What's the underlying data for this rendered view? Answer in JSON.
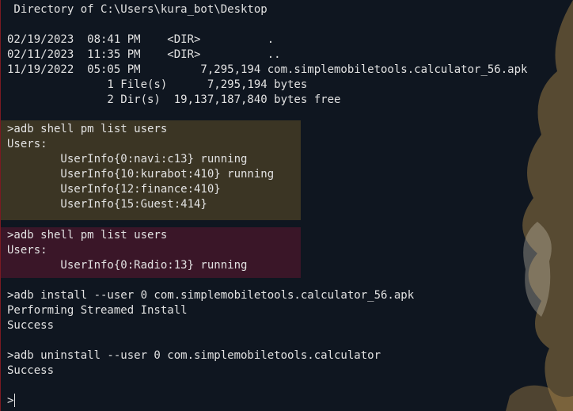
{
  "terminal": {
    "dir_header": " Directory of C:\\Users\\kura_bot\\Desktop",
    "dir_entries": [
      "02/19/2023  08:41 PM    <DIR>          .",
      "02/11/2023  11:35 PM    <DIR>          ..",
      "11/19/2022  05:05 PM         7,295,194 com.simplemobiletools.calculator_56.apk"
    ],
    "dir_summary": [
      "               1 File(s)      7,295,194 bytes",
      "               2 Dir(s)  19,137,187,840 bytes free"
    ],
    "block1": [
      ">adb shell pm list users",
      "Users:",
      "        UserInfo{0:navi:c13} running",
      "        UserInfo{10:kurabot:410} running",
      "        UserInfo{12:finance:410}",
      "        UserInfo{15:Guest:414}"
    ],
    "block2": [
      ">adb shell pm list users",
      "Users:",
      "        UserInfo{0:Radio:13} running"
    ],
    "install": [
      ">adb install --user 0 com.simplemobiletools.calculator_56.apk",
      "Performing Streamed Install",
      "Success"
    ],
    "uninstall": [
      ">adb uninstall --user 0 com.simplemobiletools.calculator",
      "Success"
    ],
    "prompt": ">"
  },
  "colors": {
    "background": "#0f1620",
    "highlight_olive": "#3b3524",
    "highlight_maroon": "#3a1628",
    "art": "#b08a4a"
  }
}
